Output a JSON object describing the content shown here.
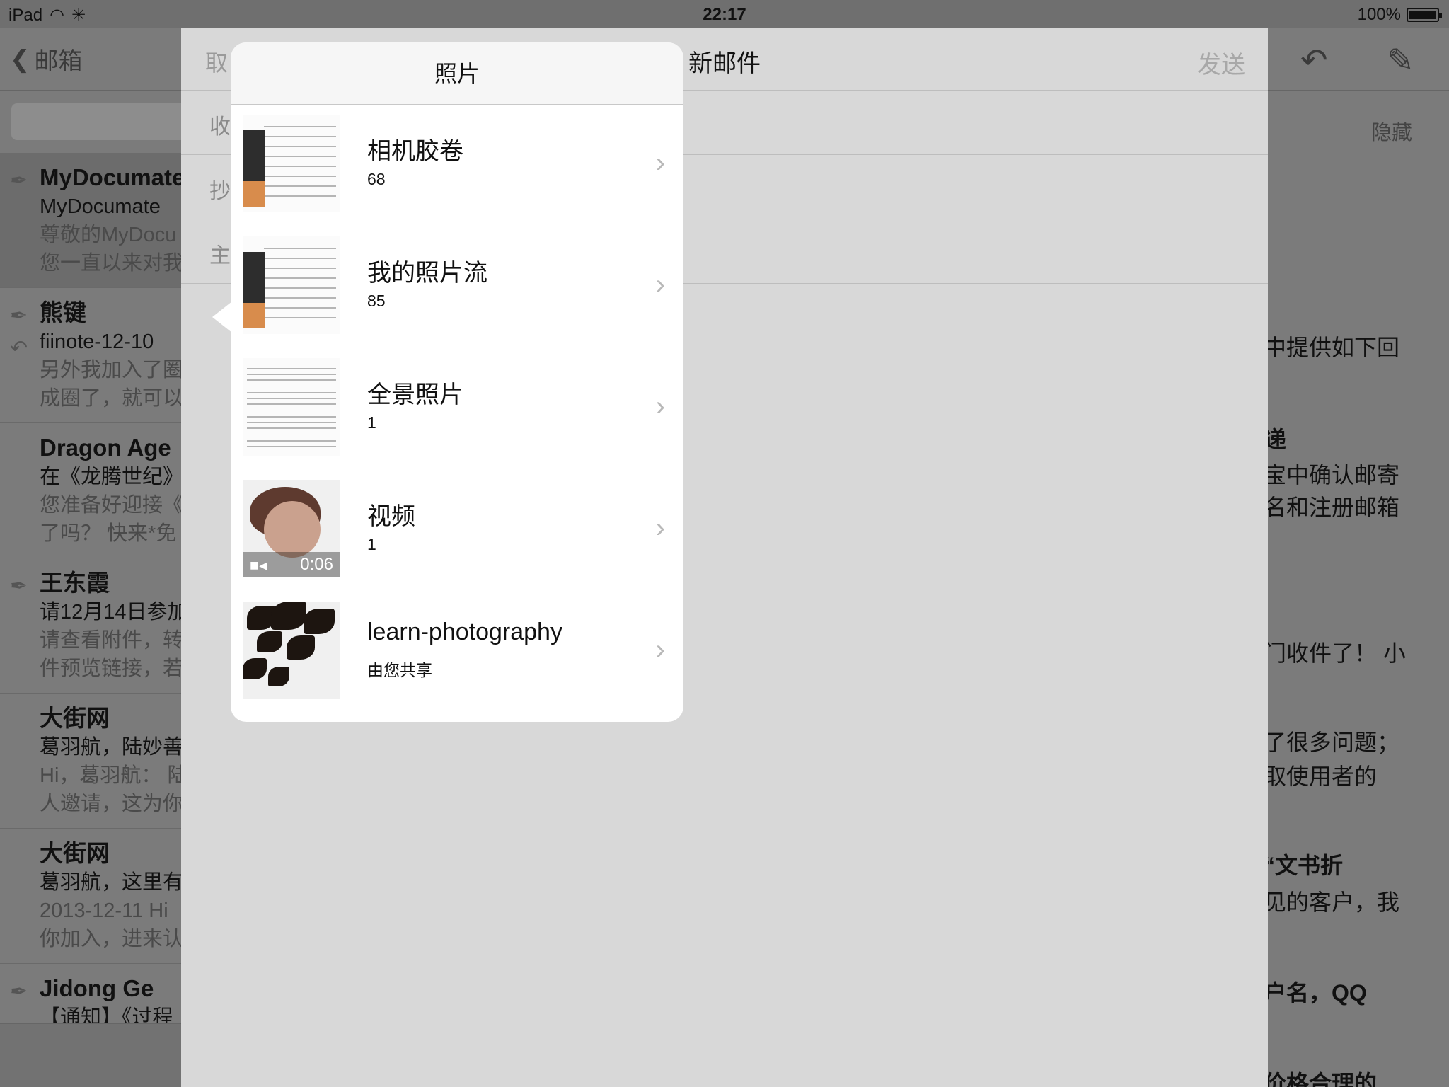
{
  "status_bar": {
    "device": "iPad",
    "time": "22:17",
    "battery": "100%"
  },
  "inbox": {
    "back_label": "邮箱",
    "messages": [
      {
        "from": "MyDocumate",
        "subject": "MyDocumate",
        "preview1": "尊敬的MyDocu",
        "preview2": "您一直以来对我"
      },
      {
        "from": "熊键",
        "subject": "fiinote-12-10",
        "preview1": "另外我加入了圈",
        "preview2": "成圈了，就可以"
      },
      {
        "from": "Dragon Age",
        "subject": "在《龙腾世纪》",
        "preview1": "您准备好迎接《",
        "preview2": "了吗？ 快来*免"
      },
      {
        "from": "王东霞",
        "subject": "请12月14日参加",
        "preview1": "请查看附件，转",
        "preview2": "件预览链接，若"
      },
      {
        "from": "大街网",
        "subject": "葛羽航，陆妙善",
        "preview1": "Hi，葛羽航：  陆",
        "preview2": "人邀请，这为你"
      },
      {
        "from": "大街网",
        "subject": "葛羽航，这里有",
        "preview1": "2013-12-11 Hi",
        "preview2": "你加入，进来认"
      },
      {
        "from": "Jidong Ge",
        "subject": "【通知】《过程",
        "preview1": "",
        "preview2": ""
      }
    ]
  },
  "content": {
    "hide_label": "隐藏",
    "lines": [
      {
        "text": "中提供如下回",
        "bold": false
      },
      {
        "text": "递",
        "bold": true
      },
      {
        "text": "宝中确认邮寄",
        "bold": false
      },
      {
        "text": "名和注册邮箱",
        "bold": false
      },
      {
        "text": "门收件了！ 小",
        "bold": false
      },
      {
        "text": "了很多问题；",
        "bold": false
      },
      {
        "text": "取使用者的",
        "bold": false
      },
      {
        "text": "“文书折",
        "bold": true
      },
      {
        "text": "见的客户，我",
        "bold": false
      },
      {
        "text": "户名，QQ",
        "bold": true
      },
      {
        "text": "价格合理的",
        "bold": true
      }
    ]
  },
  "compose": {
    "cancel_label": "取",
    "title": "新邮件",
    "send_label": "发送",
    "fields": {
      "to_label": "收",
      "cc_label": "抄",
      "subject_label": "主"
    }
  },
  "popover": {
    "title": "照片",
    "albums": [
      {
        "name": "相机胶卷",
        "count": "68",
        "thumb": "sheet-music-portrait"
      },
      {
        "name": "我的照片流",
        "count": "85",
        "thumb": "sheet-music-portrait"
      },
      {
        "name": "全景照片",
        "count": "1",
        "thumb": "score"
      },
      {
        "name": "视频",
        "count": "1",
        "thumb": "video",
        "duration": "0:06"
      },
      {
        "name": "learn-photography",
        "count": "由您共享",
        "thumb": "sunset-leaves"
      }
    ]
  }
}
